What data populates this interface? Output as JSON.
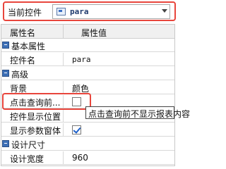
{
  "top": {
    "label": "当前控件",
    "combo_value": "para"
  },
  "grid": {
    "header_name": "属性名",
    "header_value": "属性值",
    "rows": [
      {
        "type": "category",
        "label": "基本属性"
      },
      {
        "type": "prop",
        "name": "控件名",
        "value": "para"
      },
      {
        "type": "category",
        "label": "高级"
      },
      {
        "type": "prop",
        "name": "背景",
        "value": "颜色"
      },
      {
        "type": "prop",
        "name": "点击查询前...",
        "checked": false
      },
      {
        "type": "prop",
        "name": "控件显示位置",
        "value": ""
      },
      {
        "type": "prop",
        "name": "显示参数窗体",
        "checked": true
      },
      {
        "type": "category",
        "label": "设计尺寸"
      },
      {
        "type": "prop",
        "name": "设计宽度",
        "value": "960"
      }
    ]
  },
  "tooltip": "点击查询前不显示报表内容",
  "colors": {
    "highlight": "#e8453c",
    "category_toggle": "#3d6fb6",
    "check": "#1c5fc9"
  }
}
